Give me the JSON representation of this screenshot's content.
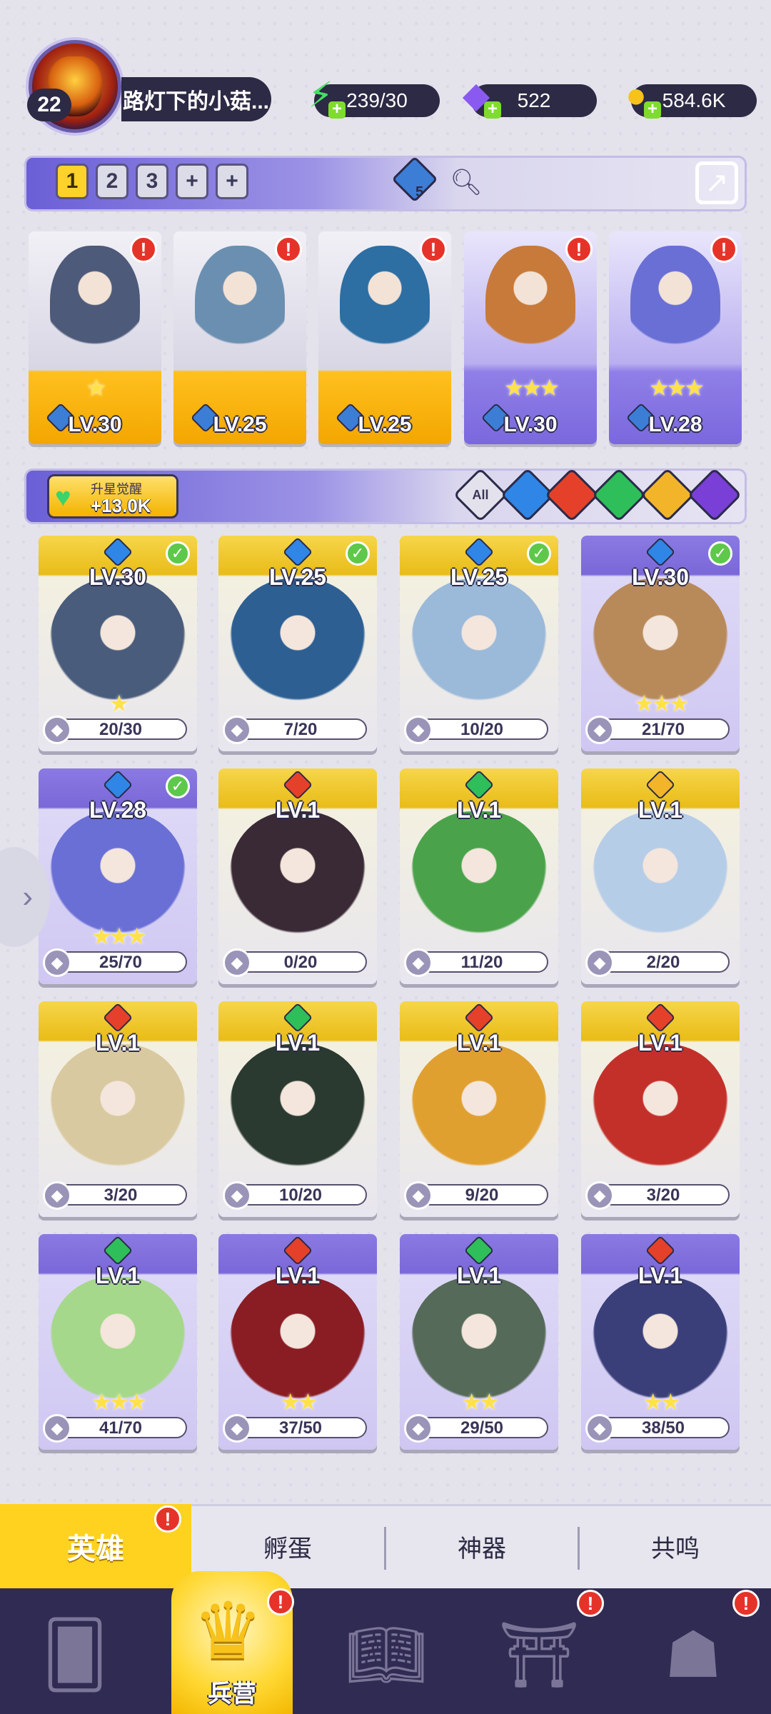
{
  "player": {
    "level": "22",
    "name": "路灯下的小菇..."
  },
  "resources": {
    "energy": "239/30",
    "gems": "522",
    "coins": "584.6K"
  },
  "team": {
    "tabs": [
      "1",
      "2",
      "3",
      "+",
      "+"
    ],
    "active_tab_index": 0,
    "crystal_count": "5",
    "cards": [
      {
        "level": "LV.30",
        "rarity": "gold",
        "stars": "★",
        "color": "#4d5a7a"
      },
      {
        "level": "LV.25",
        "rarity": "gold",
        "stars": "",
        "color": "#6b8fb0"
      },
      {
        "level": "LV.25",
        "rarity": "gold",
        "stars": "",
        "color": "#2d6ea3"
      },
      {
        "level": "LV.30",
        "rarity": "purple",
        "stars": "★★★",
        "color": "#c77a3a"
      },
      {
        "level": "LV.28",
        "rarity": "purple",
        "stars": "★★★",
        "color": "#6a6fd6"
      }
    ]
  },
  "awaken": {
    "label": "升星觉醒",
    "value": "+13.0K"
  },
  "filters": {
    "all": "All",
    "elements": [
      {
        "name": "water",
        "color": "#2f86e6"
      },
      {
        "name": "fire",
        "color": "#e5412a"
      },
      {
        "name": "nature",
        "color": "#2fbf5a"
      },
      {
        "name": "light",
        "color": "#f2b52a"
      },
      {
        "name": "dark",
        "color": "#7a3fd6"
      }
    ]
  },
  "heroes": [
    {
      "level": "LV.30",
      "progress": "20/30",
      "rarity": "gold",
      "element": "#2f86e6",
      "owned": true,
      "stars": "★",
      "art": "#4a5c7c"
    },
    {
      "level": "LV.25",
      "progress": "7/20",
      "rarity": "gold",
      "element": "#2f86e6",
      "owned": true,
      "stars": "",
      "art": "#2d5f93"
    },
    {
      "level": "LV.25",
      "progress": "10/20",
      "rarity": "gold",
      "element": "#2f86e6",
      "owned": true,
      "stars": "",
      "art": "#9bb9d9"
    },
    {
      "level": "LV.30",
      "progress": "21/70",
      "rarity": "purple",
      "element": "#2f86e6",
      "owned": true,
      "stars": "★★★",
      "art": "#b88a5a"
    },
    {
      "level": "LV.28",
      "progress": "25/70",
      "rarity": "purple",
      "element": "#2f86e6",
      "owned": true,
      "stars": "★★★",
      "art": "#6a6fd6"
    },
    {
      "level": "LV.1",
      "progress": "0/20",
      "rarity": "gold",
      "element": "#e5412a",
      "owned": false,
      "stars": "",
      "art": "#3a2a36"
    },
    {
      "level": "LV.1",
      "progress": "11/20",
      "rarity": "gold",
      "element": "#2fbf5a",
      "owned": false,
      "stars": "",
      "art": "#4aa34a"
    },
    {
      "level": "LV.1",
      "progress": "2/20",
      "rarity": "gold",
      "element": "#f2b52a",
      "owned": false,
      "stars": "",
      "art": "#b6cde8"
    },
    {
      "level": "LV.1",
      "progress": "3/20",
      "rarity": "gold",
      "element": "#e5412a",
      "owned": false,
      "stars": "",
      "art": "#d9c9a0"
    },
    {
      "level": "LV.1",
      "progress": "10/20",
      "rarity": "gold",
      "element": "#2fbf5a",
      "owned": false,
      "stars": "",
      "art": "#2a3a30"
    },
    {
      "level": "LV.1",
      "progress": "9/20",
      "rarity": "gold",
      "element": "#e5412a",
      "owned": false,
      "stars": "",
      "art": "#e0a030"
    },
    {
      "level": "LV.1",
      "progress": "3/20",
      "rarity": "gold",
      "element": "#e5412a",
      "owned": false,
      "stars": "",
      "art": "#c3302a"
    },
    {
      "level": "LV.1",
      "progress": "41/70",
      "rarity": "purple",
      "element": "#2fbf5a",
      "owned": false,
      "stars": "★★★",
      "art": "#a5d88a"
    },
    {
      "level": "LV.1",
      "progress": "37/50",
      "rarity": "purple",
      "element": "#e5412a",
      "owned": false,
      "stars": "★★",
      "art": "#8a1c24"
    },
    {
      "level": "LV.1",
      "progress": "29/50",
      "rarity": "purple",
      "element": "#2fbf5a",
      "owned": false,
      "stars": "★★",
      "art": "#556a58"
    },
    {
      "level": "LV.1",
      "progress": "38/50",
      "rarity": "purple",
      "element": "#e5412a",
      "owned": false,
      "stars": "★★",
      "art": "#3a3f7a"
    }
  ],
  "subtabs": [
    "英雄",
    "孵蛋",
    "神器",
    "共鸣"
  ],
  "nav": {
    "active_label": "兵营",
    "icons": [
      "cards-icon",
      "barracks-icon",
      "map-book-icon",
      "temple-icon",
      "mushroom-icon"
    ]
  }
}
